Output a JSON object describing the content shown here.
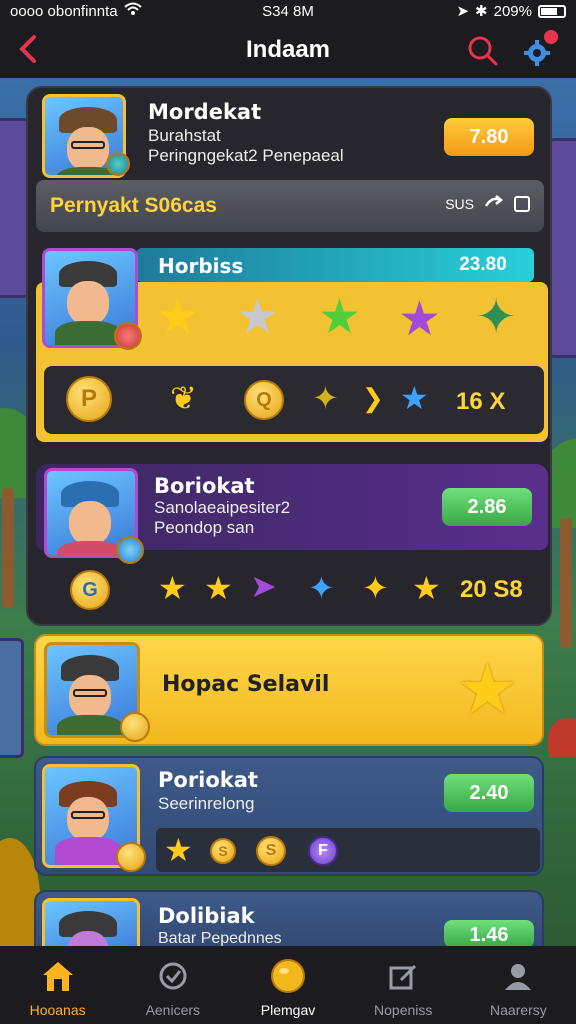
{
  "status": {
    "carrier": "oooo obonfinnta",
    "time": "S34 8M",
    "battery": "209%"
  },
  "header": {
    "title": "Indaam"
  },
  "cards": [
    {
      "name": "Mordekat",
      "sub1": "Burahstat",
      "sub2": "Peringngekat2 Penepaeal",
      "price": "7.80"
    },
    {
      "name": "Horbiss",
      "price": "23.80",
      "count": "16 X"
    },
    {
      "name": "Boriokat",
      "sub1": "Sanolaeaipesiter2",
      "sub2": "Peondop san",
      "price": "2.86",
      "count": "20 S8"
    },
    {
      "name": "Hopac Selavil"
    },
    {
      "name": "Poriokat",
      "sub1": "Seerinrelong",
      "price": "2.40"
    },
    {
      "name": "Dolibiak",
      "sub1": "Batar Pepednnes",
      "price": "1.46"
    }
  ],
  "section": {
    "label": "Pernyakt S06cas",
    "right": "SUS"
  },
  "nav": [
    {
      "label": "Hooanas",
      "icon": "home-icon"
    },
    {
      "label": "Aenicers",
      "icon": "badge-icon"
    },
    {
      "label": "Plemgav",
      "icon": "coin-icon"
    },
    {
      "label": "Nopeniss",
      "icon": "edit-icon"
    },
    {
      "label": "Naarersy",
      "icon": "profile-icon"
    }
  ]
}
